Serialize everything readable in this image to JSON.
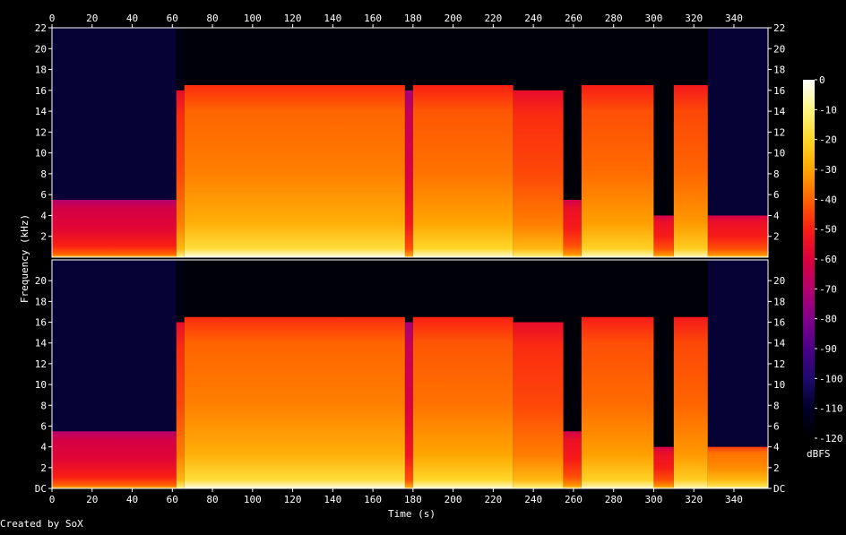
{
  "chart_data": {
    "type": "heatmap",
    "xlabel": "Time (s)",
    "ylabel": "Frequency (kHz)",
    "credit": "Created by SoX",
    "colorbar_label": "dBFS",
    "x_ticks": [
      0,
      20,
      40,
      60,
      80,
      100,
      120,
      140,
      160,
      180,
      200,
      220,
      240,
      260,
      280,
      300,
      320,
      340
    ],
    "xlim": [
      0,
      357
    ],
    "y_ticks_top": [
      "2",
      "4",
      "6",
      "8",
      "10",
      "12",
      "14",
      "16",
      "18",
      "20",
      "22"
    ],
    "y_ticks_bottom": [
      "DC",
      "2",
      "4",
      "6",
      "8",
      "10",
      "12",
      "14",
      "16",
      "18",
      "20"
    ],
    "ylim_khz": [
      0,
      22
    ],
    "colorbar_ticks": [
      0,
      -10,
      -20,
      -30,
      -40,
      -50,
      -60,
      -70,
      -80,
      -90,
      -100,
      -110,
      -120
    ],
    "colorbar_range": [
      -120,
      0
    ],
    "channels": [
      {
        "segments": [
          {
            "t0": 0,
            "t1": 62,
            "cutoff_khz": 5.5,
            "dbfs": -62,
            "floor_dbfs": -108
          },
          {
            "t0": 62,
            "t1": 66,
            "cutoff_khz": 16,
            "dbfs": -48,
            "floor_dbfs": -115
          },
          {
            "t0": 66,
            "t1": 176,
            "cutoff_khz": 16.5,
            "dbfs": -40,
            "floor_dbfs": -118
          },
          {
            "t0": 176,
            "t1": 180,
            "cutoff_khz": 16,
            "dbfs": -65,
            "floor_dbfs": -118
          },
          {
            "t0": 180,
            "t1": 230,
            "cutoff_khz": 16.5,
            "dbfs": -42,
            "floor_dbfs": -118
          },
          {
            "t0": 230,
            "t1": 255,
            "cutoff_khz": 16,
            "dbfs": -48,
            "floor_dbfs": -118
          },
          {
            "t0": 255,
            "t1": 264,
            "cutoff_khz": 5.5,
            "dbfs": -55,
            "floor_dbfs": -118
          },
          {
            "t0": 264,
            "t1": 300,
            "cutoff_khz": 16.5,
            "dbfs": -43,
            "floor_dbfs": -118
          },
          {
            "t0": 300,
            "t1": 310,
            "cutoff_khz": 4,
            "dbfs": -55,
            "floor_dbfs": -118
          },
          {
            "t0": 310,
            "t1": 327,
            "cutoff_khz": 16.5,
            "dbfs": -44,
            "floor_dbfs": -118
          },
          {
            "t0": 327,
            "t1": 357,
            "cutoff_khz": 4,
            "dbfs": -55,
            "floor_dbfs": -108
          }
        ]
      },
      {
        "segments": [
          {
            "t0": 0,
            "t1": 62,
            "cutoff_khz": 5.5,
            "dbfs": -62,
            "floor_dbfs": -108
          },
          {
            "t0": 62,
            "t1": 66,
            "cutoff_khz": 16,
            "dbfs": -48,
            "floor_dbfs": -115
          },
          {
            "t0": 66,
            "t1": 176,
            "cutoff_khz": 16.5,
            "dbfs": -40,
            "floor_dbfs": -118
          },
          {
            "t0": 176,
            "t1": 180,
            "cutoff_khz": 16,
            "dbfs": -65,
            "floor_dbfs": -118
          },
          {
            "t0": 180,
            "t1": 230,
            "cutoff_khz": 16.5,
            "dbfs": -42,
            "floor_dbfs": -118
          },
          {
            "t0": 230,
            "t1": 255,
            "cutoff_khz": 16,
            "dbfs": -48,
            "floor_dbfs": -118
          },
          {
            "t0": 255,
            "t1": 264,
            "cutoff_khz": 5.5,
            "dbfs": -55,
            "floor_dbfs": -118
          },
          {
            "t0": 264,
            "t1": 300,
            "cutoff_khz": 16.5,
            "dbfs": -43,
            "floor_dbfs": -118
          },
          {
            "t0": 300,
            "t1": 310,
            "cutoff_khz": 4,
            "dbfs": -55,
            "floor_dbfs": -118
          },
          {
            "t0": 310,
            "t1": 327,
            "cutoff_khz": 16.5,
            "dbfs": -44,
            "floor_dbfs": -118
          },
          {
            "t0": 327,
            "t1": 357,
            "cutoff_khz": 4,
            "dbfs": -38,
            "floor_dbfs": -108
          }
        ]
      }
    ]
  }
}
